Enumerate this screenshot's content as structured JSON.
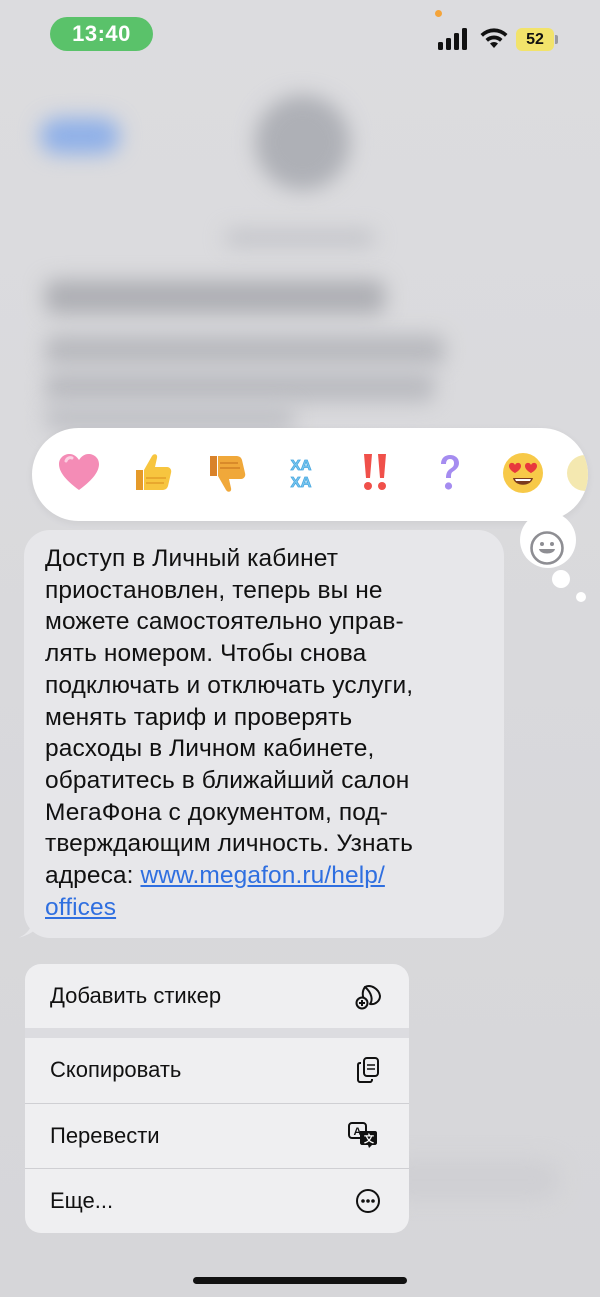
{
  "status_bar": {
    "time": "13:40",
    "battery": "52"
  },
  "reactions": [
    {
      "icon": "heart-icon"
    },
    {
      "icon": "thumbs-up-icon"
    },
    {
      "icon": "thumbs-down-icon"
    },
    {
      "icon": "haha-icon",
      "text": "ХА ХА"
    },
    {
      "icon": "double-exclamation-icon"
    },
    {
      "icon": "question-icon"
    },
    {
      "icon": "heart-eyes-icon"
    },
    {
      "icon": "partial-emoji-icon"
    }
  ],
  "message": {
    "lines": [
      "Доступ в Личный кабинет",
      "приостановлен, теперь вы не",
      "можете самостоятельно управ-",
      "лять номером. Чтобы снова",
      "подключать и отключать услуги,",
      "менять тариф и проверять",
      "расходы в Личном кабинете,",
      "обратитесь в ближайший салон",
      "МегаФона с документом, под-",
      "тверждающим личность. Узнать"
    ],
    "address_prefix": "адреса: ",
    "link_part1": "www.megafon.ru/help/",
    "link_part2": "offices"
  },
  "menu": {
    "add_sticker": "Добавить стикер",
    "copy": "Скопировать",
    "translate": "Перевести",
    "more": "Еще..."
  },
  "colors": {
    "accent_link": "#2f6fe0",
    "time_pill": "#5ac26a",
    "battery": "#f2e36b"
  }
}
